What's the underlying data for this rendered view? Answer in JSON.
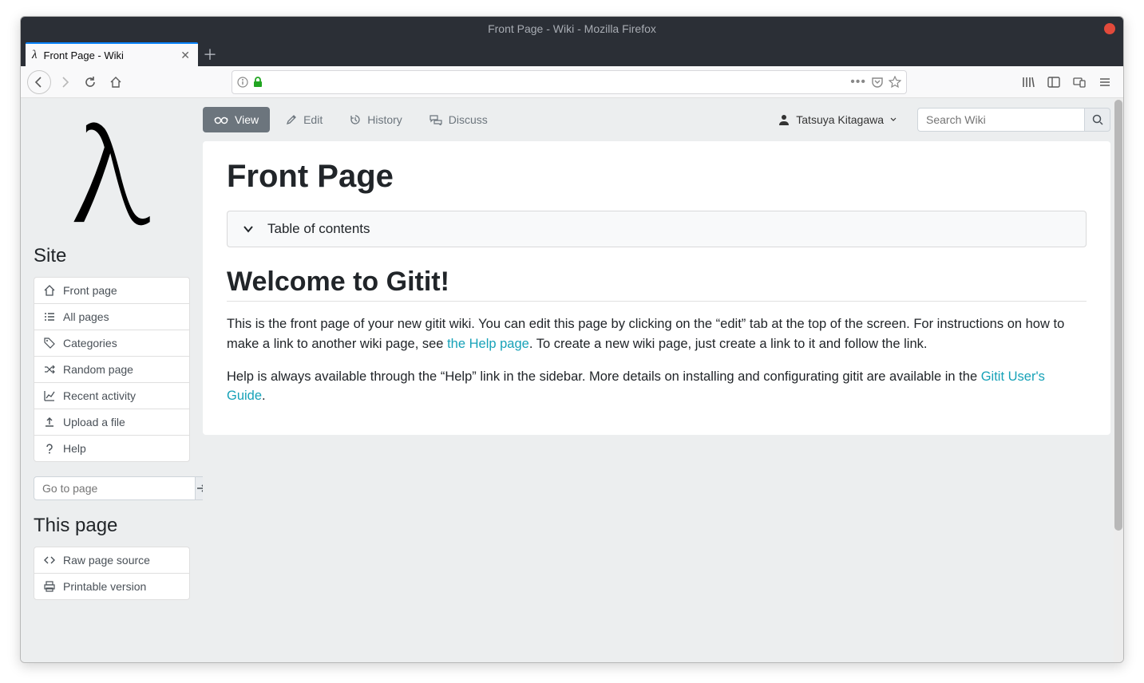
{
  "window": {
    "title": "Front Page - Wiki - Mozilla Firefox"
  },
  "tab": {
    "favicon": "λ",
    "title": "Front Page - Wiki"
  },
  "sidebar": {
    "heading_site": "Site",
    "items": [
      {
        "label": "Front page"
      },
      {
        "label": "All pages"
      },
      {
        "label": "Categories"
      },
      {
        "label": "Random page"
      },
      {
        "label": "Recent activity"
      },
      {
        "label": "Upload a file"
      },
      {
        "label": "Help"
      }
    ],
    "goto_placeholder": "Go to page",
    "heading_thispage": "This page",
    "thispage_items": [
      {
        "label": "Raw page source"
      },
      {
        "label": "Printable version"
      }
    ]
  },
  "tabs": {
    "view": "View",
    "edit": "Edit",
    "history": "History",
    "discuss": "Discuss"
  },
  "user": {
    "name": "Tatsuya Kitagawa"
  },
  "search": {
    "placeholder": "Search Wiki"
  },
  "article": {
    "title": "Front Page",
    "toc": "Table of contents",
    "heading": "Welcome to Gitit!",
    "p1_a": "This is the front page of your new gitit wiki. You can edit this page by clicking on the “edit” tab at the top of the screen. For instructions on how to make a link to another wiki page, see ",
    "p1_link": "the Help page",
    "p1_b": ". To create a new wiki page, just create a link to it and follow the link.",
    "p2_a": "Help is always available through the “Help” link in the sidebar. More details on installing and configurating gitit are available in the ",
    "p2_link": "Gitit User's Guide",
    "p2_b": "."
  }
}
